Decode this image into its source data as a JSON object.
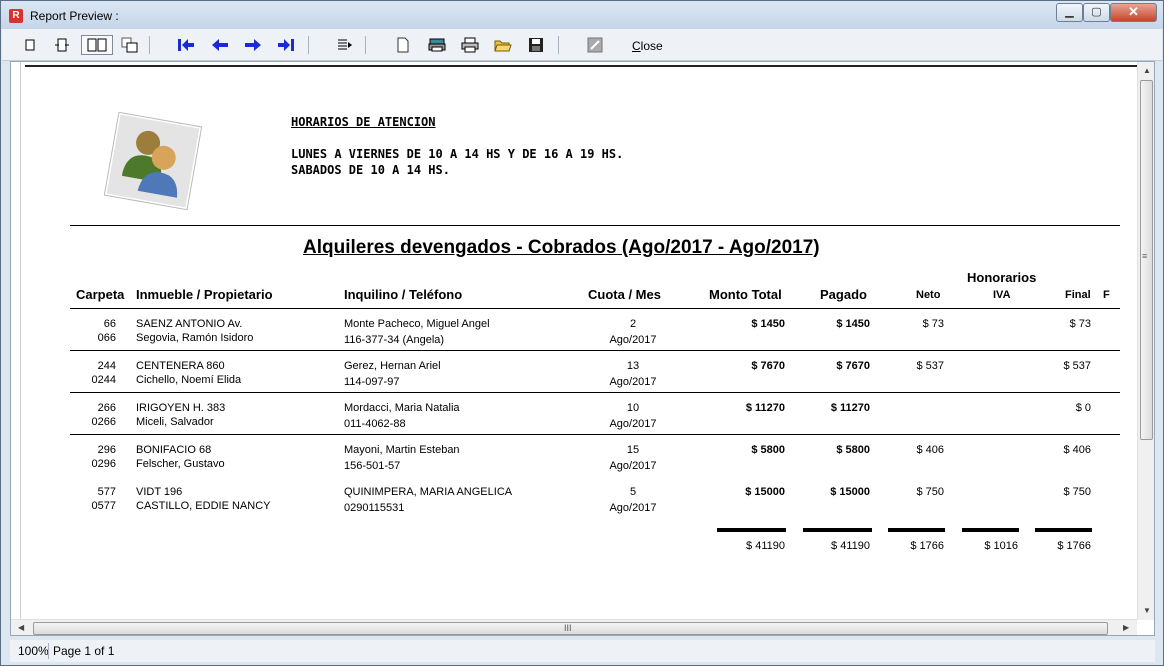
{
  "window": {
    "title": "Report Preview :",
    "app_icon_letter": "R",
    "close_label_mnemonic": "C",
    "close_label_rest": "lose"
  },
  "status": {
    "zoom": "100%",
    "page": "Page 1 of 1"
  },
  "report": {
    "schedule_title": "HORARIOS DE ATENCION",
    "schedule_line1": "LUNES A VIERNES DE 10 A 14 HS Y DE 16 A 19 HS.",
    "schedule_line2": "SABADOS DE 10 A 14 HS.",
    "title": "Alquileres devengados - Cobrados (Ago/2017 - Ago/2017)",
    "columns": {
      "carpeta": "Carpeta",
      "inmueble": "Inmueble / Propietario",
      "inquilino": "Inquilino / Teléfono",
      "cuota": "Cuota / Mes",
      "monto": "Monto Total",
      "pagado": "Pagado",
      "honorarios": "Honorarios",
      "neto": "Neto",
      "iva": "IVA",
      "final": "Final",
      "extra": "F"
    },
    "rows": [
      {
        "carpeta": "66",
        "carpeta2": "066",
        "inmueble": "SAENZ ANTONIO Av.",
        "propietario": "Segovia, Ramón Isidoro",
        "inquilino": "Monte Pacheco, Miguel Angel",
        "telefono": "116-377-34      (Angela)",
        "cuota": "2",
        "mes": "Ago/2017",
        "monto": "$ 1450",
        "pagado": "$ 1450",
        "neto": "$ 73",
        "iva": "",
        "final": "$ 73"
      },
      {
        "carpeta": "244",
        "carpeta2": "0244",
        "inmueble": "CENTENERA 860",
        "propietario": "Cichello, Noemí Elida",
        "inquilino": "Gerez, Hernan Ariel",
        "telefono": "114-097-97",
        "cuota": "13",
        "mes": "Ago/2017",
        "monto": "$ 7670",
        "pagado": "$ 7670",
        "neto": "$ 537",
        "iva": "",
        "final": "$ 537"
      },
      {
        "carpeta": "266",
        "carpeta2": "0266",
        "inmueble": "IRIGOYEN H. 383",
        "propietario": "Miceli, Salvador",
        "inquilino": "Mordacci, Maria Natalia",
        "telefono": "011-4062-88",
        "cuota": "10",
        "mes": "Ago/2017",
        "monto": "$ 11270",
        "pagado": "$ 11270",
        "neto": "",
        "iva": "",
        "final": "$ 0"
      },
      {
        "carpeta": "296",
        "carpeta2": "0296",
        "inmueble": "BONIFACIO 68",
        "propietario": "Felscher, Gustavo",
        "inquilino": "Mayoni, Martin Esteban",
        "telefono": "156-501-57",
        "cuota": "15",
        "mes": "Ago/2017",
        "monto": "$ 5800",
        "pagado": "$ 5800",
        "neto": "$ 406",
        "iva": "",
        "final": "$ 406"
      },
      {
        "carpeta": "577",
        "carpeta2": "0577",
        "inmueble": "VIDT 196",
        "propietario": "CASTILLO, EDDIE NANCY",
        "inquilino": "QUINIMPERA, MARIA ANGELICA",
        "telefono": "0290115531",
        "cuota": "5",
        "mes": "Ago/2017",
        "monto": "$ 15000",
        "pagado": "$ 15000",
        "neto": "$ 750",
        "iva": "",
        "final": "$ 750"
      }
    ],
    "totals": {
      "monto": "$ 41190",
      "pagado": "$ 41190",
      "neto": "$ 1766",
      "iva": "$ 1016",
      "final": "$ 1766"
    }
  },
  "scrollbar": {
    "h_grip": "III",
    "v_grip": "≡"
  }
}
